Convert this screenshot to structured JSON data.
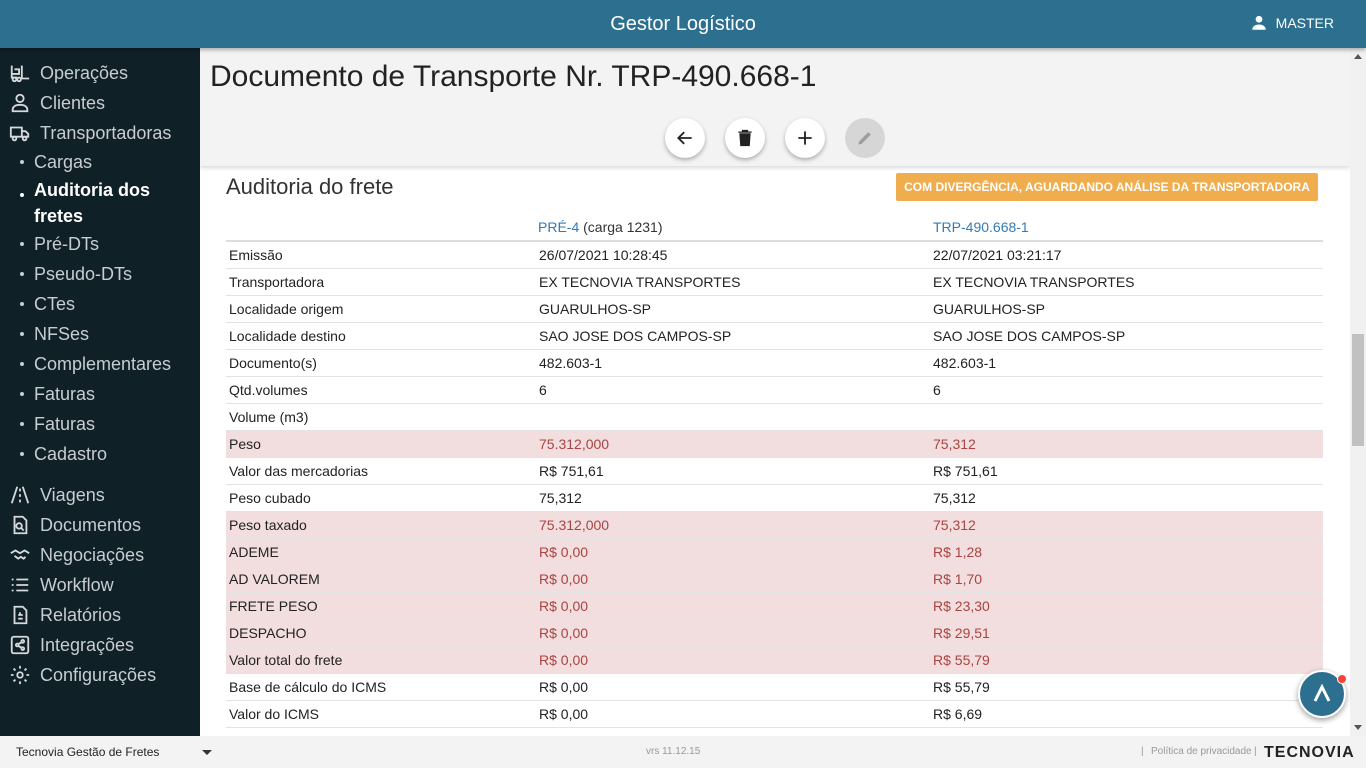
{
  "header": {
    "title": "Gestor Logístico",
    "user": "MASTER"
  },
  "sidebar": {
    "top_items": [
      {
        "label": "Operações",
        "icon": "forklift-icon"
      },
      {
        "label": "Clientes",
        "icon": "person-icon"
      },
      {
        "label": "Transportadoras",
        "icon": "truck-icon"
      }
    ],
    "sub_items": [
      {
        "label": "Cargas"
      },
      {
        "label": "Auditoria dos fretes",
        "active": true
      },
      {
        "label": "Pré-DTs"
      },
      {
        "label": "Pseudo-DTs"
      },
      {
        "label": "CTes"
      },
      {
        "label": "NFSes"
      },
      {
        "label": "Complementares"
      },
      {
        "label": "Faturas"
      },
      {
        "label": "Faturas"
      },
      {
        "label": "Cadastro"
      }
    ],
    "bottom_items": [
      {
        "label": "Viagens",
        "icon": "road-icon"
      },
      {
        "label": "Documentos",
        "icon": "document-search-icon"
      },
      {
        "label": "Negociações",
        "icon": "handshake-icon"
      },
      {
        "label": "Workflow",
        "icon": "list-icon"
      },
      {
        "label": "Relatórios",
        "icon": "report-icon"
      },
      {
        "label": "Integrações",
        "icon": "share-icon"
      },
      {
        "label": "Configurações",
        "icon": "gear-icon"
      }
    ]
  },
  "page": {
    "title": "Documento de Transporte Nr. TRP-490.668-1",
    "actions": [
      {
        "name": "back",
        "icon": "arrow-left-icon"
      },
      {
        "name": "delete",
        "icon": "trash-icon"
      },
      {
        "name": "add",
        "icon": "plus-icon"
      },
      {
        "name": "edit",
        "icon": "pencil-icon",
        "disabled": true
      }
    ]
  },
  "audit": {
    "title": "Auditoria do frete",
    "status": "COM DIVERGÊNCIA, AGUARDANDO ANÁLISE DA TRANSPORTADORA",
    "status_color": "#f0ad4e",
    "columns": {
      "col1_link": "PRÉ-4",
      "col1_note": "(carga 1231)",
      "col2_link": "TRP-490.668-1"
    },
    "rows": [
      {
        "label": "Emissão",
        "a": "26/07/2021 10:28:45",
        "b": "22/07/2021 03:21:17",
        "diff": false
      },
      {
        "label": "Transportadora",
        "a": "EX TECNOVIA TRANSPORTES",
        "b": "EX TECNOVIA TRANSPORTES",
        "diff": false
      },
      {
        "label": "Localidade origem",
        "a": "GUARULHOS-SP",
        "b": "GUARULHOS-SP",
        "diff": false
      },
      {
        "label": "Localidade destino",
        "a": "SAO JOSE DOS CAMPOS-SP",
        "b": "SAO JOSE DOS CAMPOS-SP",
        "diff": false
      },
      {
        "label": "Documento(s)",
        "a": "482.603-1",
        "b": "482.603-1",
        "diff": false
      },
      {
        "label": "Qtd.volumes",
        "a": "6",
        "b": "6",
        "diff": false
      },
      {
        "label": "Volume (m3)",
        "a": "",
        "b": "",
        "diff": false
      },
      {
        "label": "Peso",
        "a": "75.312,000",
        "b": "75,312",
        "diff": true
      },
      {
        "label": "Valor das mercadorias",
        "a": "R$ 751,61",
        "b": "R$ 751,61",
        "diff": false
      },
      {
        "label": "Peso cubado",
        "a": "75,312",
        "b": "75,312",
        "diff": false
      },
      {
        "label": "Peso taxado",
        "a": "75.312,000",
        "b": "75,312",
        "diff": true
      },
      {
        "label": "ADEME",
        "a": "R$ 0,00",
        "b": "R$ 1,28",
        "diff": true
      },
      {
        "label": "AD VALOREM",
        "a": "R$ 0,00",
        "b": "R$ 1,70",
        "diff": true
      },
      {
        "label": "FRETE PESO",
        "a": "R$ 0,00",
        "b": "R$ 23,30",
        "diff": true
      },
      {
        "label": "DESPACHO",
        "a": "R$ 0,00",
        "b": "R$ 29,51",
        "diff": true
      },
      {
        "label": "Valor total do frete",
        "a": "R$ 0,00",
        "b": "R$ 55,79",
        "diff": true
      },
      {
        "label": "Base de cálculo do ICMS",
        "a": "R$ 0,00",
        "b": "R$ 55,79",
        "diff": false
      },
      {
        "label": "Valor do ICMS",
        "a": "R$ 0,00",
        "b": "R$ 6,69",
        "diff": false
      }
    ]
  },
  "footer": {
    "system_select": "Tecnovia Gestão de Fretes",
    "version": "vrs 11.12.15",
    "privacy": "Política de privacidade",
    "brand": "TECNOVIA"
  }
}
